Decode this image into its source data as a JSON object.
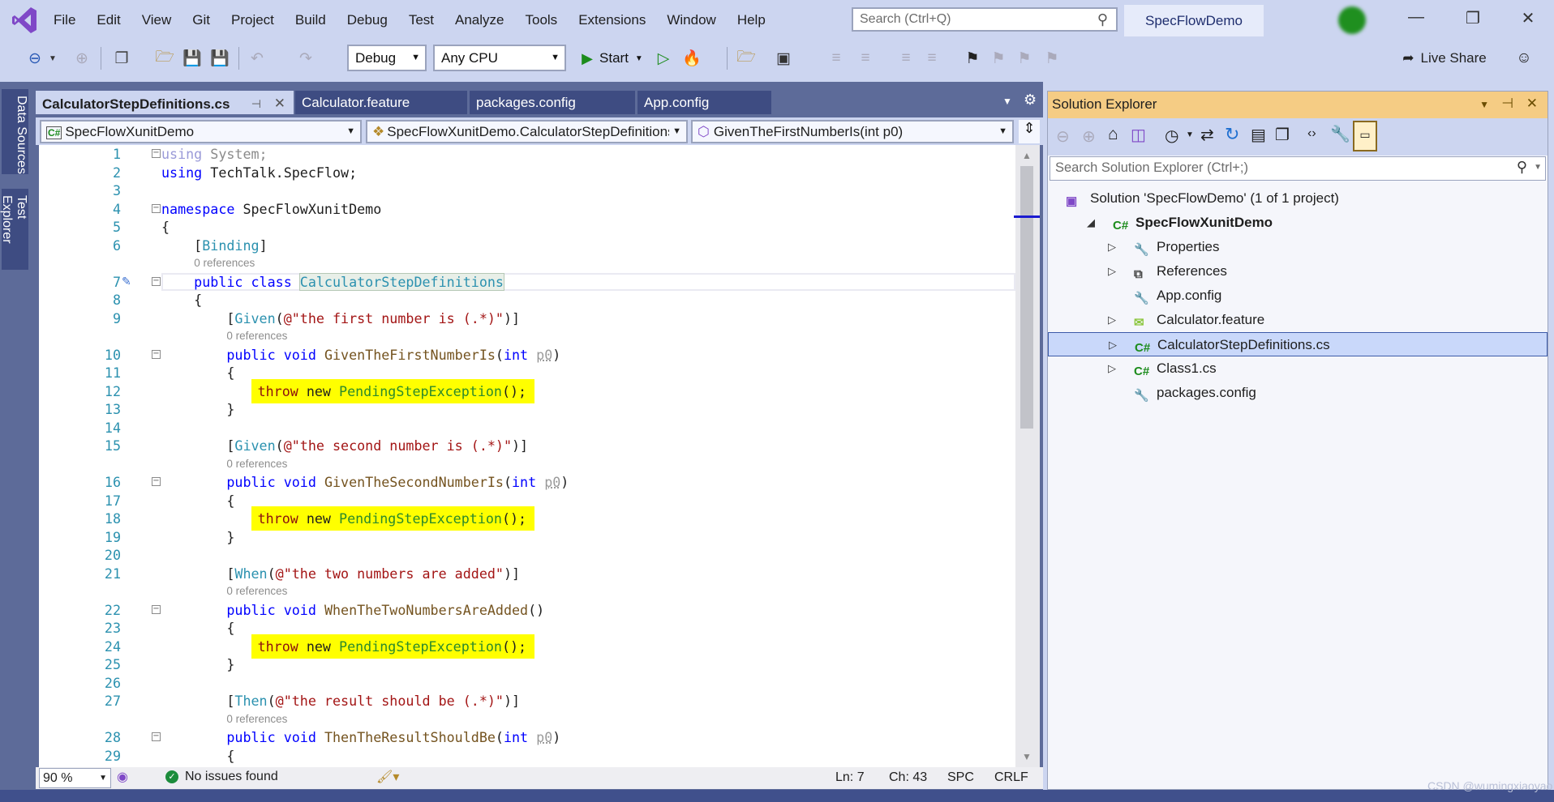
{
  "app": {
    "menu": [
      "File",
      "Edit",
      "View",
      "Git",
      "Project",
      "Build",
      "Debug",
      "Test",
      "Analyze",
      "Tools",
      "Extensions",
      "Window",
      "Help"
    ],
    "search_placeholder": "Search (Ctrl+Q)",
    "solution_name": "SpecFlowDemo",
    "live_share": "Live Share",
    "accent": "#68217a"
  },
  "toolbar": {
    "configuration": "Debug",
    "platform": "Any CPU",
    "start": "Start"
  },
  "side_tabs": [
    "Data Sources",
    "Test Explorer"
  ],
  "tabs": [
    {
      "label": "CalculatorStepDefinitions.cs",
      "active": true
    },
    {
      "label": "Calculator.feature",
      "active": false
    },
    {
      "label": "packages.config",
      "active": false
    },
    {
      "label": "App.config",
      "active": false
    }
  ],
  "navbar": {
    "project": "SpecFlowXunitDemo",
    "type": "SpecFlowXunitDemo.CalculatorStepDefinitions",
    "member": "GivenTheFirstNumberIs(int p0)"
  },
  "editor": {
    "rows": [
      {
        "n": "1",
        "fold": true,
        "tokens": [
          {
            "t": "using",
            "c": "fa"
          },
          {
            "t": " System;",
            "c": "gr"
          }
        ]
      },
      {
        "n": "2",
        "tokens": [
          {
            "t": "using",
            "c": "kw"
          },
          {
            "t": " TechTalk.SpecFlow;",
            "c": ""
          }
        ]
      },
      {
        "n": "3",
        "tokens": []
      },
      {
        "n": "4",
        "fold": true,
        "tokens": [
          {
            "t": "namespace",
            "c": "kw"
          },
          {
            "t": " SpecFlowXunitDemo",
            "c": ""
          }
        ]
      },
      {
        "n": "5",
        "tokens": [
          {
            "t": "{",
            "c": ""
          }
        ]
      },
      {
        "n": "6",
        "tokens": [
          {
            "t": "    [",
            "c": ""
          },
          {
            "t": "Binding",
            "c": "ty"
          },
          {
            "t": "]",
            "c": ""
          }
        ]
      },
      {
        "refs": "0 references",
        "indent": 4
      },
      {
        "n": "7",
        "fold": true,
        "current": true,
        "tokens": [
          {
            "t": "    public class ",
            "c": "kw"
          },
          {
            "t": "CalculatorStepDefinitions",
            "c": "cls"
          }
        ]
      },
      {
        "n": "8",
        "tokens": [
          {
            "t": "    {",
            "c": ""
          }
        ]
      },
      {
        "n": "9",
        "tokens": [
          {
            "t": "        [",
            "c": ""
          },
          {
            "t": "Given",
            "c": "ty"
          },
          {
            "t": "(",
            "c": ""
          },
          {
            "t": "@\"the first number is (.*)\"",
            "c": "st"
          },
          {
            "t": ")]",
            "c": ""
          }
        ]
      },
      {
        "refs": "0 references",
        "indent": 8
      },
      {
        "n": "10",
        "fold": true,
        "tokens": [
          {
            "t": "        public void ",
            "c": "kw"
          },
          {
            "t": "GivenTheFirstNumberIs",
            "c": "me"
          },
          {
            "t": "(",
            "c": ""
          },
          {
            "t": "int",
            "c": "kw"
          },
          {
            "t": " ",
            "c": ""
          },
          {
            "t": "p0",
            "c": "pa"
          },
          {
            "t": ")",
            "c": ""
          }
        ]
      },
      {
        "n": "11",
        "tokens": [
          {
            "t": "        {",
            "c": ""
          }
        ]
      },
      {
        "n": "12",
        "hl": true,
        "tokens": [
          {
            "t": "throw",
            "c": "th"
          },
          {
            "t": " new ",
            "c": ""
          },
          {
            "t": "PendingStepException",
            "c": "ex"
          },
          {
            "t": "();",
            "c": ""
          }
        ]
      },
      {
        "n": "13",
        "tokens": [
          {
            "t": "        }",
            "c": ""
          }
        ]
      },
      {
        "n": "14",
        "tokens": []
      },
      {
        "n": "15",
        "tokens": [
          {
            "t": "        [",
            "c": ""
          },
          {
            "t": "Given",
            "c": "ty"
          },
          {
            "t": "(",
            "c": ""
          },
          {
            "t": "@\"the second number is (.*)\"",
            "c": "st"
          },
          {
            "t": ")]",
            "c": ""
          }
        ]
      },
      {
        "refs": "0 references",
        "indent": 8
      },
      {
        "n": "16",
        "fold": true,
        "tokens": [
          {
            "t": "        public void ",
            "c": "kw"
          },
          {
            "t": "GivenTheSecondNumberIs",
            "c": "me"
          },
          {
            "t": "(",
            "c": ""
          },
          {
            "t": "int",
            "c": "kw"
          },
          {
            "t": " ",
            "c": ""
          },
          {
            "t": "p0",
            "c": "pa"
          },
          {
            "t": ")",
            "c": ""
          }
        ]
      },
      {
        "n": "17",
        "tokens": [
          {
            "t": "        {",
            "c": ""
          }
        ]
      },
      {
        "n": "18",
        "hl": true,
        "tokens": [
          {
            "t": "throw",
            "c": "th"
          },
          {
            "t": " new ",
            "c": ""
          },
          {
            "t": "PendingStepException",
            "c": "ex"
          },
          {
            "t": "();",
            "c": ""
          }
        ]
      },
      {
        "n": "19",
        "tokens": [
          {
            "t": "        }",
            "c": ""
          }
        ]
      },
      {
        "n": "20",
        "tokens": []
      },
      {
        "n": "21",
        "tokens": [
          {
            "t": "        [",
            "c": ""
          },
          {
            "t": "When",
            "c": "ty"
          },
          {
            "t": "(",
            "c": ""
          },
          {
            "t": "@\"the two numbers are added\"",
            "c": "st"
          },
          {
            "t": ")]",
            "c": ""
          }
        ]
      },
      {
        "refs": "0 references",
        "indent": 8
      },
      {
        "n": "22",
        "fold": true,
        "tokens": [
          {
            "t": "        public void ",
            "c": "kw"
          },
          {
            "t": "WhenTheTwoNumbersAreAdded",
            "c": "me"
          },
          {
            "t": "()",
            "c": ""
          }
        ]
      },
      {
        "n": "23",
        "tokens": [
          {
            "t": "        {",
            "c": ""
          }
        ]
      },
      {
        "n": "24",
        "hl": true,
        "tokens": [
          {
            "t": "throw",
            "c": "th"
          },
          {
            "t": " new ",
            "c": ""
          },
          {
            "t": "PendingStepException",
            "c": "ex"
          },
          {
            "t": "();",
            "c": ""
          }
        ]
      },
      {
        "n": "25",
        "tokens": [
          {
            "t": "        }",
            "c": ""
          }
        ]
      },
      {
        "n": "26",
        "tokens": []
      },
      {
        "n": "27",
        "tokens": [
          {
            "t": "        [",
            "c": ""
          },
          {
            "t": "Then",
            "c": "ty"
          },
          {
            "t": "(",
            "c": ""
          },
          {
            "t": "@\"the result should be (.*)\"",
            "c": "st"
          },
          {
            "t": ")]",
            "c": ""
          }
        ]
      },
      {
        "refs": "0 references",
        "indent": 8
      },
      {
        "n": "28",
        "fold": true,
        "tokens": [
          {
            "t": "        public void ",
            "c": "kw"
          },
          {
            "t": "ThenTheResultShouldBe",
            "c": "me"
          },
          {
            "t": "(",
            "c": ""
          },
          {
            "t": "int",
            "c": "kw"
          },
          {
            "t": " ",
            "c": ""
          },
          {
            "t": "p0",
            "c": "pa"
          },
          {
            "t": ")",
            "c": ""
          }
        ]
      },
      {
        "n": "29",
        "tokens": [
          {
            "t": "        {",
            "c": ""
          }
        ]
      }
    ],
    "highlight_color": "#ffff00"
  },
  "status": {
    "zoom": "90 %",
    "issues": "No issues found",
    "ln": "Ln: 7",
    "ch": "Ch: 43",
    "spc": "SPC",
    "crlf": "CRLF"
  },
  "solution_explorer": {
    "title": "Solution Explorer",
    "search_placeholder": "Search Solution Explorer (Ctrl+;)",
    "header_color": "#f5cc84",
    "items": [
      {
        "label": "Solution 'SpecFlowDemo' (1 of 1 project)",
        "level": 0,
        "icon": "solution-icon"
      },
      {
        "label": "SpecFlowXunitDemo",
        "level": 1,
        "icon": "csharp-project-icon",
        "expanded": true,
        "bold": true
      },
      {
        "label": "Properties",
        "level": 2,
        "icon": "wrench-icon",
        "expandable": true
      },
      {
        "label": "References",
        "level": 2,
        "icon": "references-icon",
        "expandable": true
      },
      {
        "label": "App.config",
        "level": 2,
        "icon": "config-file-icon"
      },
      {
        "label": "Calculator.feature",
        "level": 2,
        "icon": "feature-file-icon",
        "expandable": true
      },
      {
        "label": "CalculatorStepDefinitions.cs",
        "level": 2,
        "icon": "csharp-file-icon",
        "expandable": true,
        "selected": true
      },
      {
        "label": "Class1.cs",
        "level": 2,
        "icon": "csharp-file-icon",
        "expandable": true
      },
      {
        "label": "packages.config",
        "level": 2,
        "icon": "config-file-icon"
      }
    ]
  },
  "watermark": "CSDN @wumingxiaoyao"
}
